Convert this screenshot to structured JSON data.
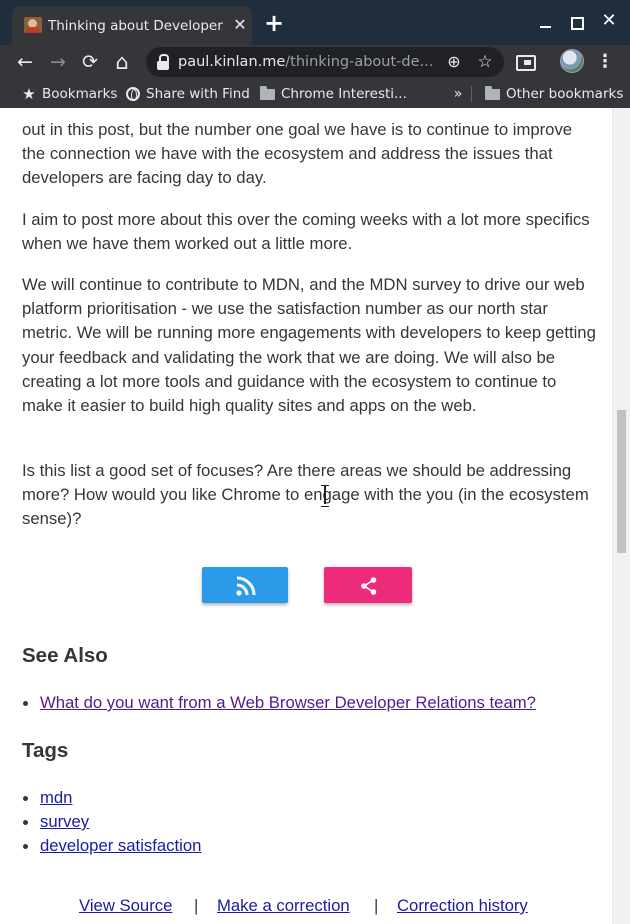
{
  "window": {
    "tab_title": "Thinking about Developer Sa",
    "tab_close_glyph": "✕",
    "new_tab_glyph": "+",
    "close_glyph": "✕"
  },
  "toolbar": {
    "back_glyph": "←",
    "forward_glyph": "→",
    "reload_glyph": "⟳",
    "home_glyph": "⌂",
    "url_host": "paul.kinlan.me",
    "url_path": "/thinking-about-de...",
    "add_glyph": "⊕",
    "star_glyph": "☆",
    "menu_glyph": "⋮"
  },
  "bookmarks": {
    "items": [
      {
        "label": "Bookmarks",
        "icon": "star-icon"
      },
      {
        "label": "Share with Find",
        "icon": "globe-icon"
      },
      {
        "label": "Chrome Interesti...",
        "icon": "folder-icon"
      }
    ],
    "overflow_glyph": "»",
    "other": {
      "label": "Other bookmarks",
      "icon": "folder-icon"
    }
  },
  "article": {
    "paragraphs": [
      "out in this post, but the number one goal we have is to continue to improve the connection we have with the ecosystem and address the issues that developers are facing day to day.",
      "I aim to post more about this over the coming weeks with a lot more specifics when we have them worked out a little more.",
      "We will continue to contribute to MDN, and the MDN survey to drive our web platform prioritisation - we use the satisfaction number as our north star metric. We will be running more engagements with developers to keep getting your feedback and validating the work that we are doing. We will also be creating a lot more tools and guidance with the ecosystem to continue to make it easier to build high quality sites and apps on the web.",
      "Is this list a good set of focuses? Are there areas we should be addressing more? How would you like Chrome to engage with the you (in the ecosystem sense)?"
    ],
    "see_also": {
      "heading": "See Also",
      "links": [
        "What do you want from a Web Browser Developer Relations team?"
      ]
    },
    "tags": {
      "heading": "Tags",
      "items": [
        "mdn",
        "survey",
        "developer satisfaction"
      ]
    },
    "buttons": {
      "rss_color": "#2b9be9",
      "share_color": "#ee2b7b"
    },
    "footer": {
      "links": [
        "View Source",
        "Make a correction",
        "Correction history"
      ],
      "separator": "|"
    }
  }
}
